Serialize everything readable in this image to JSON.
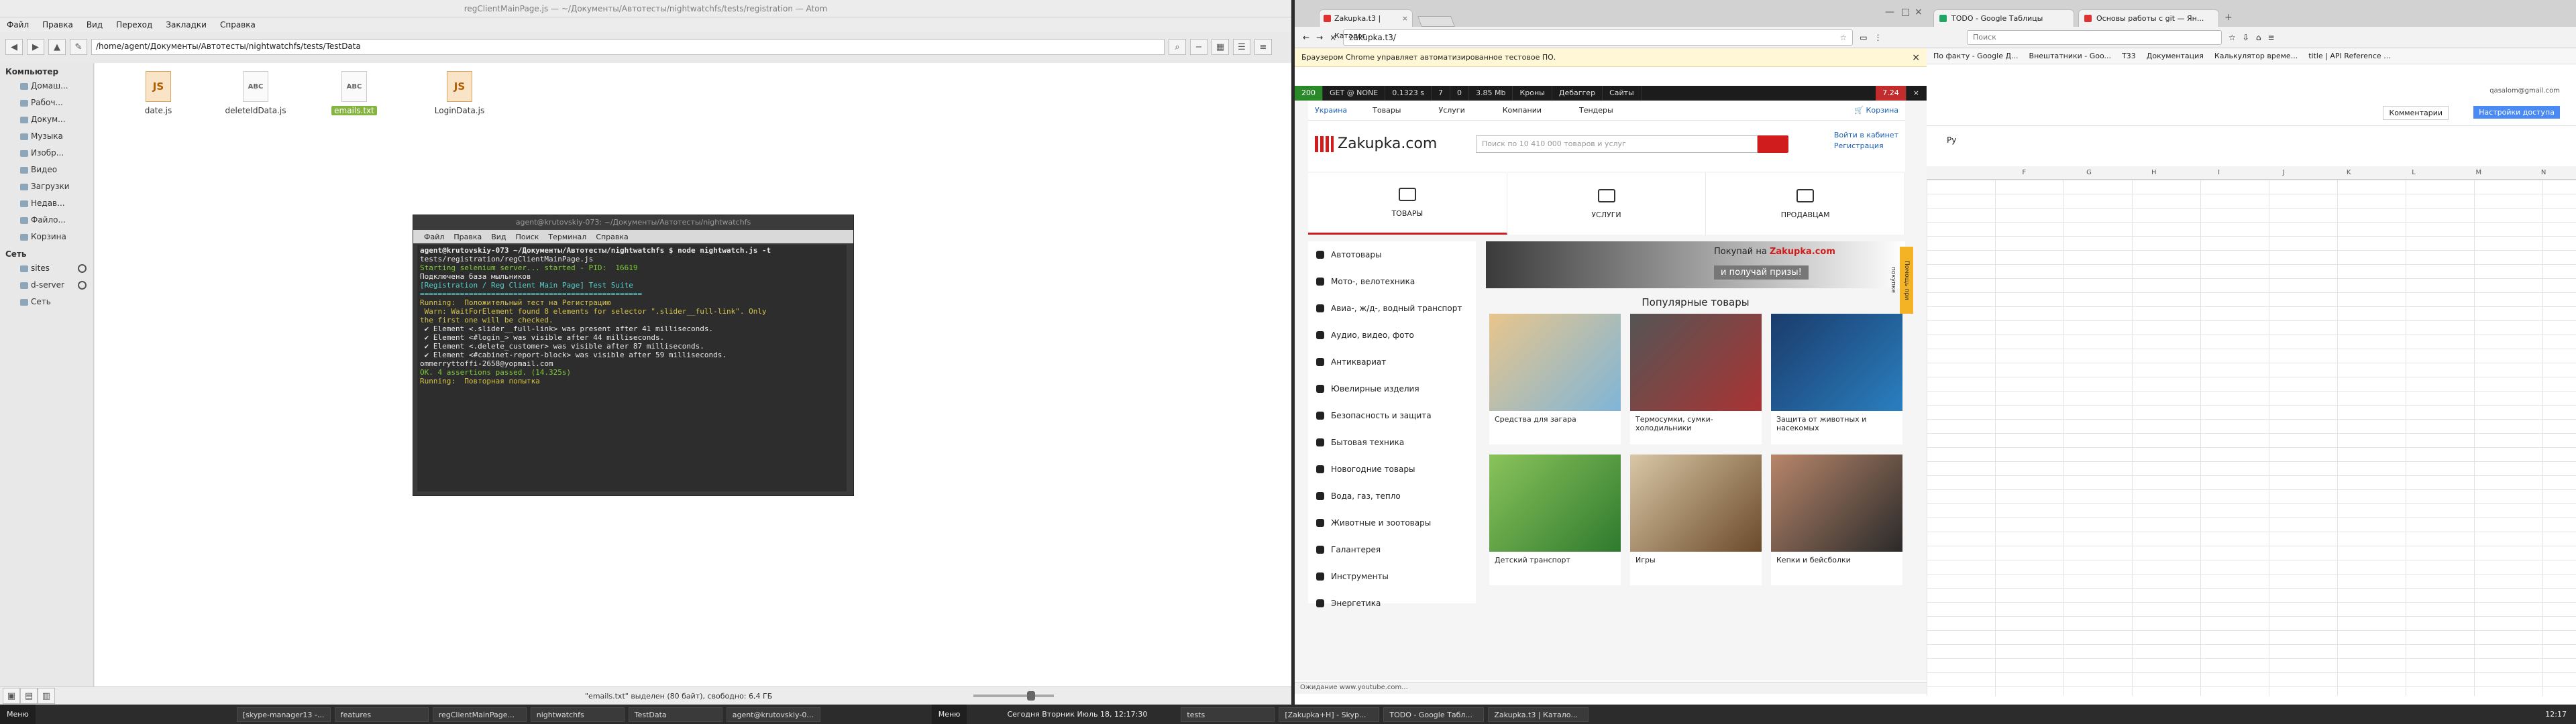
{
  "file_manager": {
    "title": "regClientMainPage.js — ~/Документы/Автотесты/nightwatchfs/tests/registration — Atom",
    "menu": [
      "Файл",
      "Правка",
      "Вид",
      "Переход",
      "Закладки",
      "Справка"
    ],
    "path": "/home/agent/Документы/Автотесты/nightwatchfs/tests/TestData",
    "sidebar": {
      "computer_header": "Компьютер",
      "computer_items": [
        "Домаш...",
        "Рабоч...",
        "Докум...",
        "Музыка",
        "Изобр...",
        "Видео",
        "Загрузки",
        "Недав...",
        "Файло...",
        "Корзина"
      ],
      "network_header": "Сеть",
      "network_items": [
        "sites",
        "d-server",
        "Сеть"
      ]
    },
    "files": [
      {
        "name": "date.js",
        "type": "js"
      },
      {
        "name": "deleteIdData.js",
        "type": "txt"
      },
      {
        "name": "emails.txt",
        "type": "txt",
        "selected": true
      },
      {
        "name": "LoginData.js",
        "type": "js"
      }
    ],
    "status": "\"emails.txt\" выделен (80 байт), свободно: 6,4 ГБ"
  },
  "terminal": {
    "title": "agent@krutovskiy-073: ~/Документы/Автотесты/nightwatchfs",
    "menu": [
      "Файл",
      "Правка",
      "Вид",
      "Поиск",
      "Терминал",
      "Справка"
    ],
    "lines": [
      {
        "text": "agent@krutovskiy-073 ~/Документы/Автотесты/nightwatchfs $ node nightwatch.js -t",
        "cls": "b"
      },
      {
        "text": "tests/registration/regClientMainPage.js",
        "cls": ""
      },
      {
        "text": "Starting selenium server... started - PID:  16619",
        "cls": "g"
      },
      {
        "text": "Подключена база мыльников",
        "cls": ""
      },
      {
        "text": "",
        "cls": ""
      },
      {
        "text": "[Registration / Reg Client Main Page] Test Suite",
        "cls": "c"
      },
      {
        "text": "==================================================",
        "cls": "c"
      },
      {
        "text": "",
        "cls": ""
      },
      {
        "text": "Running:  Положительный тест на Регистрацию",
        "cls": "y"
      },
      {
        "text": " Warn: WaitForElement found 8 elements for selector \".slider__full-link\". Only",
        "cls": "y"
      },
      {
        "text": "the first one will be checked.",
        "cls": "y"
      },
      {
        "text": " ✔ Element <.slider__full-link> was present after 41 milliseconds.",
        "cls": ""
      },
      {
        "text": " ✔ Element <#login_> was visible after 44 milliseconds.",
        "cls": ""
      },
      {
        "text": " ✔ Element <.delete_customer> was visible after 87 milliseconds.",
        "cls": ""
      },
      {
        "text": " ✔ Element <#cabinet-report-block> was visible after 59 milliseconds.",
        "cls": ""
      },
      {
        "text": "ommerryttoffi-2658@yopmail.com",
        "cls": ""
      },
      {
        "text": "",
        "cls": ""
      },
      {
        "text": "OK. 4 assertions passed. (14.325s)",
        "cls": "g"
      },
      {
        "text": "",
        "cls": ""
      },
      {
        "text": "Running:  Повторная попытка",
        "cls": "y"
      }
    ]
  },
  "chrome": {
    "tab_title": "Zakupka.t3 | Каталог",
    "url": "zakupka.t3/",
    "info_bar": "Браузером Chrome управляет автоматизированное тестовое ПО.",
    "debug_bar": [
      "200",
      "GET @ NONE",
      "0.1323 s",
      "7",
      "0",
      "3.85 Mb",
      "Кроны",
      "Дебаггер",
      "Сайты",
      "7.24"
    ],
    "top_nav": {
      "region": "Украина",
      "items": [
        "Товары",
        "Услуги",
        "Компании",
        "Тендеры"
      ],
      "cart": "Корзина"
    },
    "logo": "Zakupka.com",
    "search_placeholder": "Поиск по 10 410 000 товаров и услуг",
    "login_link": "Войти в кабинет",
    "register_link": "Регистрация",
    "cards": [
      "ТОВАРЫ",
      "УСЛУГИ",
      "ПРОДАВЦАМ"
    ],
    "categories": [
      "Автотовары",
      "Мото-, велотехника",
      "Авиа-, ж/д-, водный транспорт",
      "Аудио, видео, фото",
      "Антиквариат",
      "Ювелирные изделия",
      "Безопасность и защита",
      "Бытовая техника",
      "Новогодние товары",
      "Вода, газ, тепло",
      "Животные и зоотовары",
      "Галантерея",
      "Инструменты",
      "Энергетика"
    ],
    "banner_text": "Покупай на",
    "banner_prize": "и получай призы!",
    "popular_title": "Популярные товары",
    "products": [
      "Средства для загара",
      "Термосумки, сумки-холодильники",
      "Защита от животных и насекомых",
      "Детский транспорт",
      "Игры",
      "Кепки и бейсболки"
    ],
    "side_tag": "Помощь при покупке",
    "status": "Ожидание www.youtube.com..."
  },
  "sheets": {
    "tabs": [
      "TODO - Google Таблицы",
      "Основы работы с git — Ян..."
    ],
    "search_placeholder": "Поиск",
    "bookmarks": [
      "По факту - Google Д...",
      "Внештатники - Goo...",
      "T33",
      "Документация",
      "Калькулятор време...",
      "title | API Reference ..."
    ],
    "user": "qasalom@gmail.com",
    "comments_btn": "Комментарии",
    "access_btn": "Настройки доступа",
    "font": "Ру",
    "columns": [
      "",
      "F",
      "G",
      "H",
      "I",
      "J",
      "K",
      "L",
      "M",
      "N"
    ]
  },
  "taskbar": {
    "menu_label": "Меню",
    "windows": [
      "[skype-manager13 -...",
      "features",
      "regClientMainPage...",
      "nightwatchfs",
      "TestData",
      "agent@krutovskiy-0..."
    ],
    "menu_label2": "Меню",
    "clock_center": "Сегодня Вторник Июль 18, 12:17:30",
    "windows2": [
      "tests",
      "[Zakupka+Н] - Skyp...",
      "TODO - Google Табл...",
      "Zakupka.t3 | Катало..."
    ],
    "clock_right": "12:17"
  }
}
